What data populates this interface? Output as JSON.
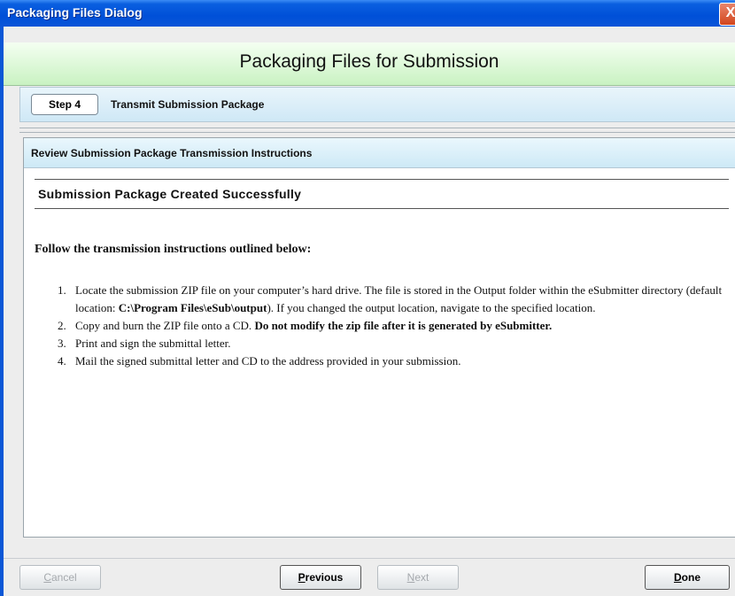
{
  "window": {
    "title": "Packaging Files Dialog",
    "close_label": "X"
  },
  "banner": {
    "heading": "Packaging Files for Submission"
  },
  "step": {
    "label": "Step 4",
    "title": "Transmit Submission Package"
  },
  "panel": {
    "header": "Review Submission Package Transmission Instructions",
    "success_title": "Submission Package Created Successfully",
    "follow_text": "Follow the transmission instructions outlined below:",
    "instructions": [
      {
        "num": "1.",
        "text_a": "Locate the submission ZIP file on your computer’s hard drive. The file is stored in the Output folder within the eSubmitter directory (default location: ",
        "bold": "C:\\Program Files\\eSub\\output",
        "text_b": "). If you changed the output location, navigate to the specified location."
      },
      {
        "num": "2.",
        "text_a": "Copy and burn the ZIP file onto a CD. ",
        "bold": "Do not modify the zip file after it is generated by eSubmitter.",
        "text_b": ""
      },
      {
        "num": "3.",
        "text_a": "Print and sign the submittal letter.",
        "bold": "",
        "text_b": ""
      },
      {
        "num": "4.",
        "text_a": "Mail the signed submittal letter and CD to the address provided in your submission.",
        "bold": "",
        "text_b": ""
      }
    ]
  },
  "buttons": {
    "cancel": {
      "first": "C",
      "rest": "ancel",
      "enabled": false
    },
    "previous": {
      "first": "P",
      "rest": "revious",
      "enabled": true
    },
    "next": {
      "first": "N",
      "rest": "ext",
      "enabled": false
    },
    "done": {
      "first": "D",
      "rest": "one",
      "enabled": true
    }
  },
  "colors": {
    "titlebar": "#0050d8",
    "banner": "#c9f2c2",
    "panel_header": "#cde9f6"
  }
}
